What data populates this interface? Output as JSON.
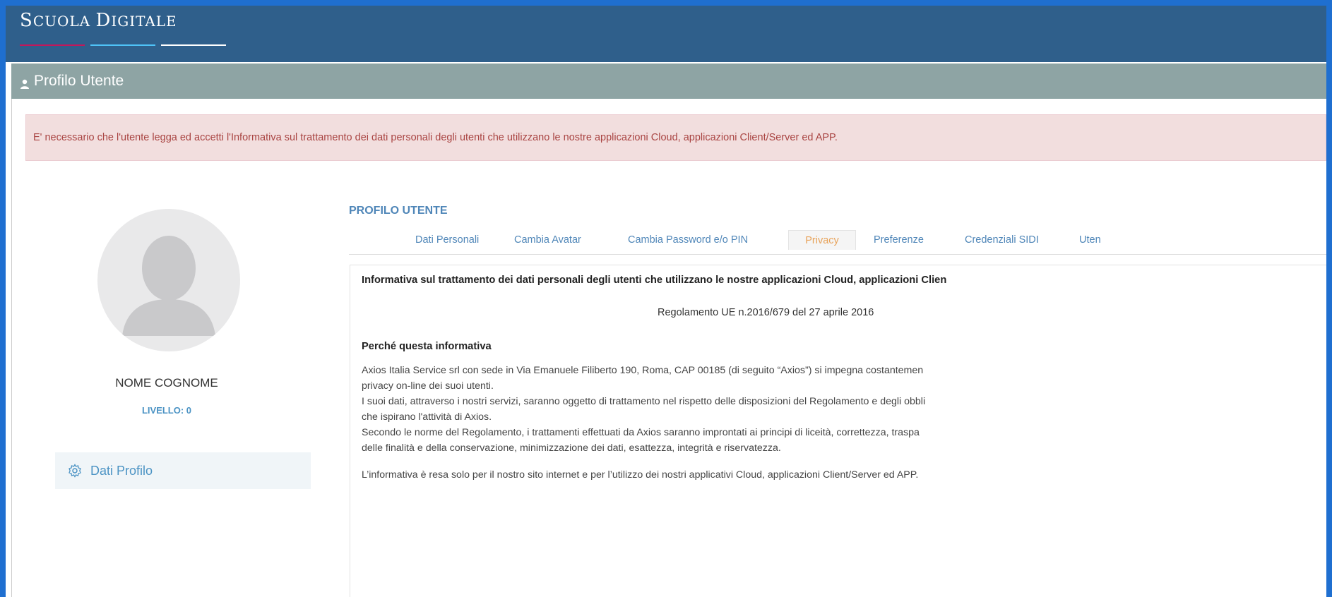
{
  "app": {
    "brand_big_1": "S",
    "brand_small_1": "CUOLA ",
    "brand_big_2": "D",
    "brand_small_2": "IGITALE",
    "brand_line_colors": [
      "#c2185b",
      "#4fc3f7",
      "#ffffff"
    ]
  },
  "panel": {
    "title": "Profilo Utente",
    "icon": "user-icon"
  },
  "alert": {
    "text": "E' necessario che l'utente legga ed accetti l'Informativa sul trattamento dei dati personali degli utenti che utilizzano le nostre applicazioni Cloud, applicazioni Client/Server ed APP."
  },
  "profile": {
    "name": "NOME COGNOME",
    "level": "LIVELLO: 0",
    "menu_item": "Dati Profilo",
    "menu_icon": "gear-icon"
  },
  "section": {
    "title": "PROFILO UTENTE"
  },
  "tabs": [
    {
      "label": "Dati Personali",
      "active": false
    },
    {
      "label": "Cambia Avatar",
      "active": false
    },
    {
      "label": "Cambia Password e/o PIN",
      "active": false
    },
    {
      "label": "Privacy",
      "active": true
    },
    {
      "label": "Preferenze",
      "active": false
    },
    {
      "label": "Credenziali SIDI",
      "active": false
    },
    {
      "label": "Uten",
      "active": false
    }
  ],
  "document": {
    "title": "Informativa sul trattamento dei dati personali degli utenti che utilizzano le nostre applicazioni Cloud, applicazioni Clien",
    "subtitle": "Regolamento UE n.2016/679 del 27 aprile 2016",
    "heading": "Perché questa informativa",
    "paragraphs": [
      "Axios Italia Service srl con sede in Via Emanuele Filiberto 190, Roma, CAP 00185 (di seguito “Axios”) si impegna costantemen",
      "privacy on-line dei suoi utenti.",
      "I suoi dati, attraverso i nostri servizi, saranno oggetto di trattamento nel rispetto delle disposizioni del Regolamento e degli obbli",
      "che ispirano l'attività di Axios.",
      "Secondo le norme del Regolamento, i trattamenti effettuati da Axios saranno improntati ai principi di liceità, correttezza, traspa",
      "delle finalità e della conservazione, minimizzazione dei dati, esattezza, integrità e riservatezza.",
      "L’informativa è resa solo per il nostro sito internet e per l’utilizzo dei nostri applicativi Cloud, applicazioni Client/Server ed APP."
    ]
  },
  "colors": {
    "topbar": "#2f5f8b",
    "panel_head": "#8ea4a4",
    "link": "#4f86b8",
    "active_tab": "#e8a35a",
    "alert_bg": "#f2dede",
    "alert_text": "#a94442"
  }
}
